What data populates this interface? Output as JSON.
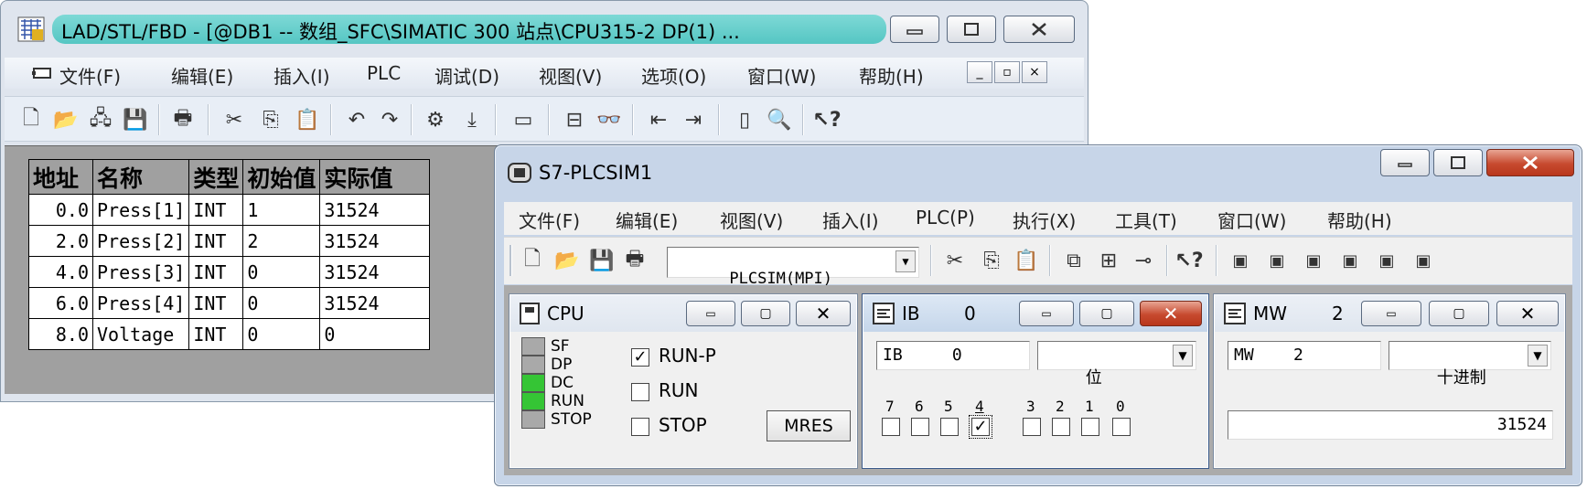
{
  "lad": {
    "title": "LAD/STL/FBD  - [@DB1 -- 数组_SFC\\SIMATIC 300 站点\\CPU315-2 DP(1)  ...",
    "menu": [
      "文件(F)",
      "编辑(E)",
      "插入(I)",
      "PLC",
      "调试(D)",
      "视图(V)",
      "选项(O)",
      "窗口(W)",
      "帮助(H)"
    ],
    "toolbar_icons": [
      "new-icon",
      "open-icon",
      "network-icon",
      "save-icon",
      "print-icon",
      "cut-icon",
      "copy-icon",
      "paste-icon",
      "undo-icon",
      "redo-icon",
      "compile-icon",
      "download-icon",
      "monitor-icon",
      "display-icon",
      "glasses-icon",
      "prev-icon",
      "next-icon",
      "window-icon",
      "zoom-icon",
      "help-icon"
    ],
    "table": {
      "headers": [
        "地址",
        "名称",
        "类型",
        "初始值",
        "实际值"
      ],
      "rows": [
        {
          "addr": "0.0",
          "name": "Press[1]",
          "type": "INT",
          "init": "1",
          "actual": "31524"
        },
        {
          "addr": "2.0",
          "name": "Press[2]",
          "type": "INT",
          "init": "2",
          "actual": "31524"
        },
        {
          "addr": "4.0",
          "name": "Press[3]",
          "type": "INT",
          "init": "0",
          "actual": "31524"
        },
        {
          "addr": "6.0",
          "name": "Press[4]",
          "type": "INT",
          "init": "0",
          "actual": "31524"
        },
        {
          "addr": "8.0",
          "name": "Voltage",
          "type": "INT",
          "init": "0",
          "actual": "0"
        }
      ]
    }
  },
  "sim": {
    "title": "S7-PLCSIM1",
    "menu": [
      "文件(F)",
      "编辑(E)",
      "视图(V)",
      "插入(I)",
      "PLC(P)",
      "执行(X)",
      "工具(T)",
      "窗口(W)",
      "帮助(H)"
    ],
    "toolbar_select": "PLCSIM(MPI)",
    "cpu": {
      "title": "CPU",
      "leds": [
        {
          "label": "SF",
          "on": false
        },
        {
          "label": "DP",
          "on": false
        },
        {
          "label": "DC",
          "on": true
        },
        {
          "label": "RUN",
          "on": true
        },
        {
          "label": "STOP",
          "on": false
        }
      ],
      "modes": [
        {
          "label": "RUN-P",
          "checked": true
        },
        {
          "label": "RUN",
          "checked": false
        },
        {
          "label": "STOP",
          "checked": false
        }
      ],
      "mres_label": "MRES"
    },
    "ib": {
      "title_type": "IB",
      "title_addr": "0",
      "addr_field": "IB     0",
      "format": "位",
      "bits": [
        {
          "n": "7",
          "checked": false
        },
        {
          "n": "6",
          "checked": false
        },
        {
          "n": "5",
          "checked": false
        },
        {
          "n": "4",
          "checked": true
        },
        {
          "n": "3",
          "checked": false
        },
        {
          "n": "2",
          "checked": false
        },
        {
          "n": "1",
          "checked": false
        },
        {
          "n": "0",
          "checked": false
        }
      ]
    },
    "mw": {
      "title_type": "MW",
      "title_addr": "2",
      "addr_field": "MW    2",
      "format": "十进制",
      "value": "31524"
    }
  },
  "colors": {
    "title_accent": "#5ec9c6",
    "led_on": "#35c535",
    "led_off": "#a9a9a9",
    "close_red": "#c74a2f"
  }
}
